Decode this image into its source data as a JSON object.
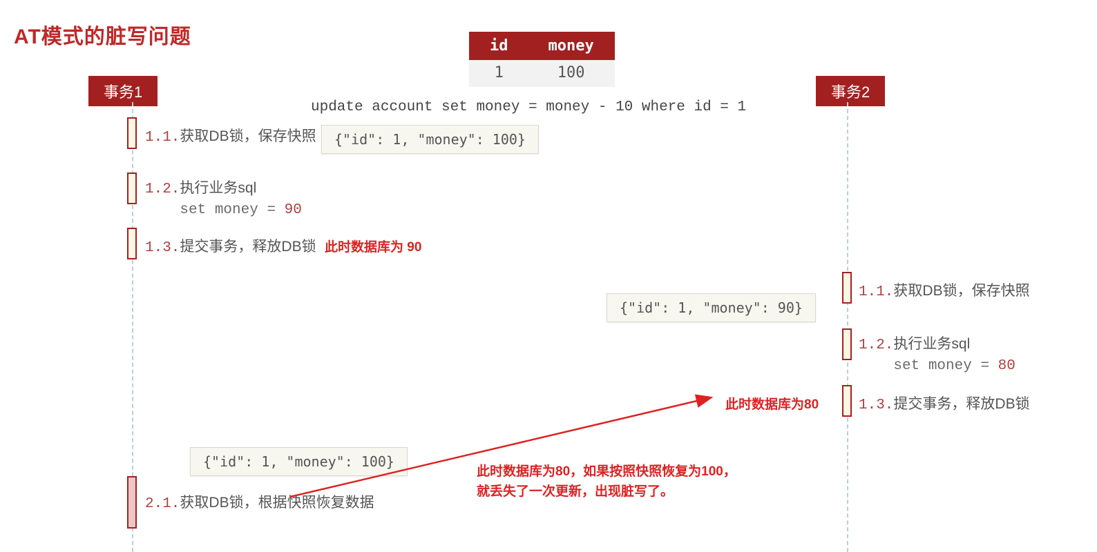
{
  "title": "AT模式的脏写问题",
  "table": {
    "headers": {
      "id": "id",
      "money": "money"
    },
    "row": {
      "id": "1",
      "money": "100"
    }
  },
  "sql": "update account set money = money - 10 where id = 1",
  "tx1": {
    "label": "事务1",
    "step11_prefix": "1.1.",
    "step11_text": "获取DB锁，保存快照",
    "step12_prefix": "1.2.",
    "step12_text": "执行业务sql",
    "step12_code": "set money = ",
    "step12_val": "90",
    "step13_prefix": "1.3.",
    "step13_text": "提交事务，释放DB锁",
    "step13_note": "此时数据库为 90",
    "step21_prefix": "2.1.",
    "step21_text": "获取DB锁，根据快照恢复数据"
  },
  "tx2": {
    "label": "事务2",
    "step11_prefix": "1.1.",
    "step11_text": "获取DB锁，保存快照",
    "step12_prefix": "1.2.",
    "step12_text": "执行业务sql",
    "step12_code": "set money = ",
    "step12_val": "80",
    "step13_prefix": "1.3.",
    "step13_text": "提交事务，释放DB锁",
    "step13_note": "此时数据库为80"
  },
  "snapshots": {
    "s1": "{\"id\": 1, \"money\": 100}",
    "s2": "{\"id\": 1, \"money\": 90}",
    "s3": "{\"id\": 1, \"money\": 100}"
  },
  "warn_line1": "此时数据库为80，如果按照快照恢复为100，",
  "warn_line2": "就丢失了一次更新，出现脏写了。"
}
